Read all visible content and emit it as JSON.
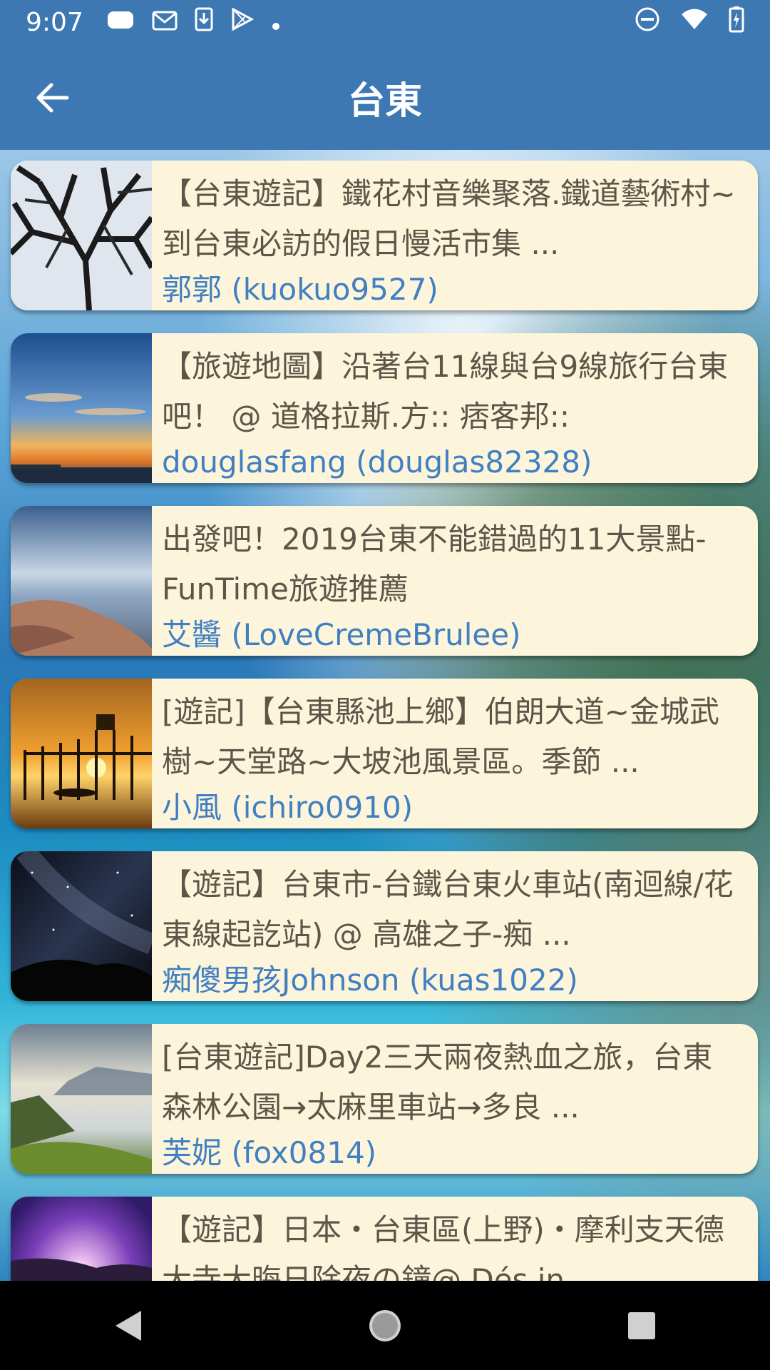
{
  "status_bar": {
    "time": "9:07",
    "left_icons": [
      "cloud-icon",
      "gmail-icon",
      "download-icon",
      "play-store-icon",
      "dot-icon"
    ],
    "right_icons": [
      "do-not-disturb-icon",
      "wifi-icon",
      "battery-icon"
    ]
  },
  "app_bar": {
    "title": "台東",
    "back_icon": "arrow-back-icon"
  },
  "colors": {
    "primary": "#3e78b2",
    "card_bg": "#fdf5db",
    "title_text": "#5d5547",
    "author_text": "#3f7fc2"
  },
  "items": [
    {
      "title": "【台東遊記】鐵花村音樂聚落.鐵道藝術村~到台東必訪的假日慢活市集 ...",
      "author": "郭郭 (kuokuo9527)",
      "thumb": "bare-tree-thumbnail"
    },
    {
      "title": "【旅遊地圖】沿著台11線與台9線旅行台東吧！ @ 道格拉斯.方:: 痞客邦::",
      "author": "douglasfang (douglas82328)",
      "thumb": "sunset-pier-thumbnail"
    },
    {
      "title": "出發吧！2019台東不能錯過的11大景點- FunTime旅遊推薦",
      "author": "艾醬 (LoveCremeBrulee)",
      "thumb": "rocky-coast-thumbnail"
    },
    {
      "title": "[遊記]【台東縣池上鄉】伯朗大道~金城武樹~天堂路~大坡池風景區。季節 ...",
      "author": "小風 (ichiro0910)",
      "thumb": "sunset-stilts-thumbnail"
    },
    {
      "title": "【遊記】台東市-台鐵台東火車站(南迴線/花東線起訖站) @ 高雄之子-痴 ...",
      "author": "痴傻男孩Johnson (kuas1022)",
      "thumb": "milky-way-thumbnail"
    },
    {
      "title": "[台東遊記]Day2三天兩夜熱血之旅，台東森林公園→太麻里車站→多良 ...",
      "author": "芙妮 (fox0814)",
      "thumb": "mountain-clouds-thumbnail"
    },
    {
      "title": "【遊記】日本・台東區(上野)・摩利支天德大寺大晦日除夜の鐘@ Dés in ...",
      "author": "",
      "thumb": "purple-sunrise-thumbnail"
    }
  ],
  "nav_bar": {
    "buttons": [
      "back-triangle-icon",
      "home-circle-icon",
      "recents-square-icon"
    ]
  }
}
